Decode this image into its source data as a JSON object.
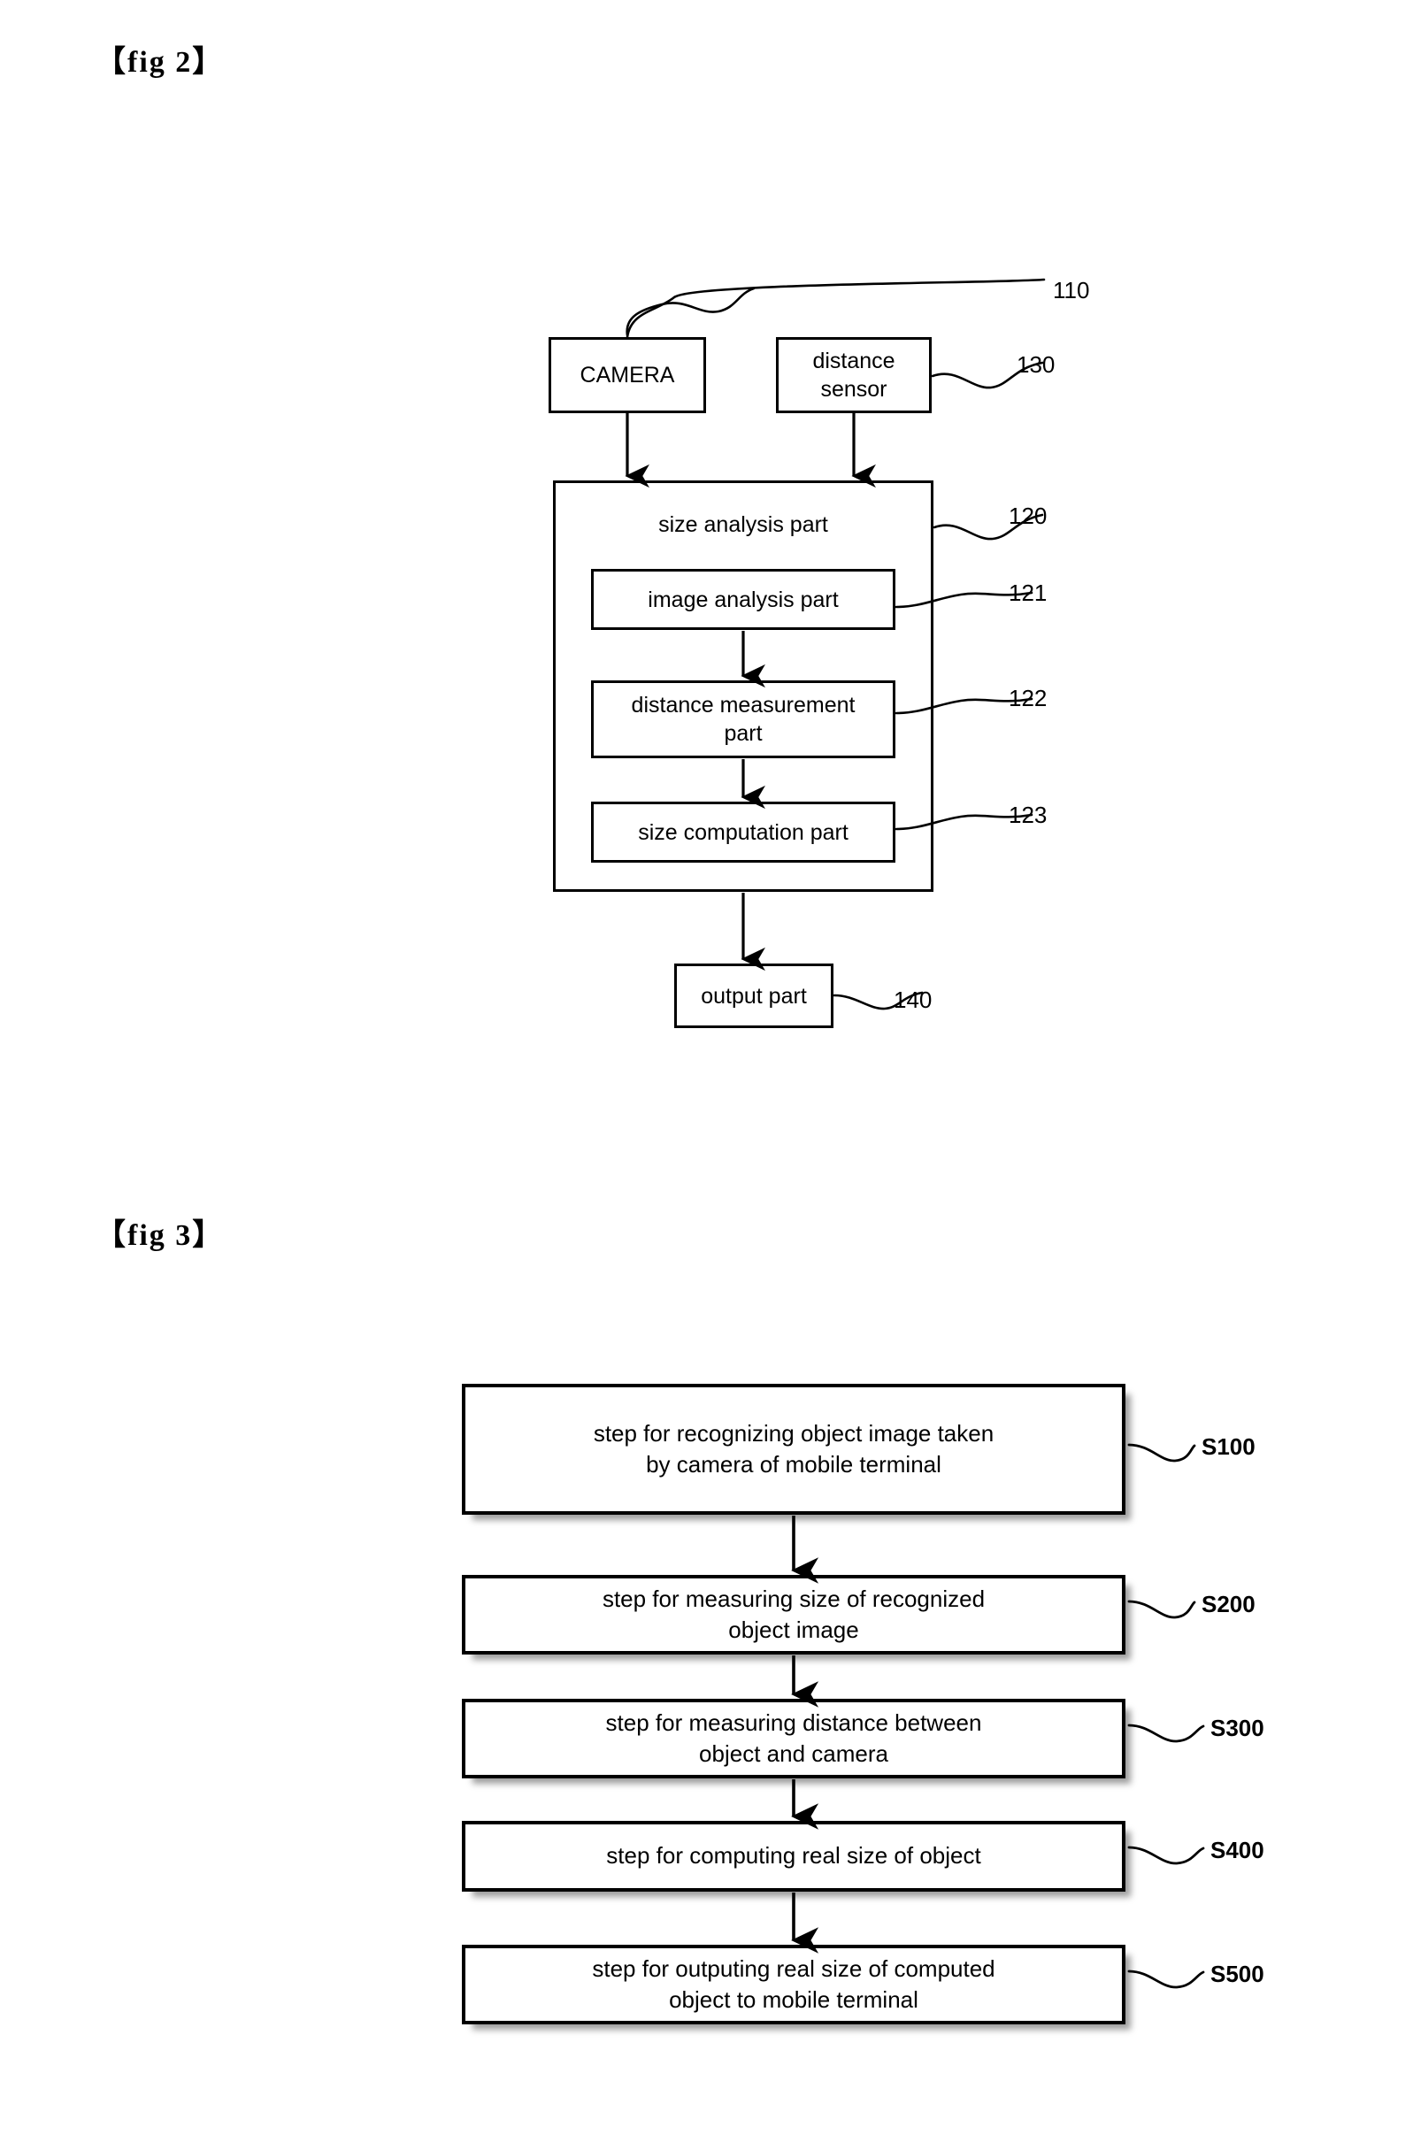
{
  "document": {
    "type": "patent-drawing-sheet",
    "figures": [
      {
        "caption": "【fig 2】",
        "kind": "block-diagram",
        "blocks": [
          {
            "id": "110",
            "label": "CAMERA"
          },
          {
            "id": "130",
            "label": "distance\nsensor"
          },
          {
            "id": "120",
            "label": "size analysis part"
          },
          {
            "id": "121",
            "label": "image analysis part"
          },
          {
            "id": "122",
            "label": "distance measurement\npart"
          },
          {
            "id": "123",
            "label": "size computation part"
          },
          {
            "id": "140",
            "label": "output part"
          }
        ]
      },
      {
        "caption": "【fig 3】",
        "kind": "flowchart",
        "steps": [
          {
            "id": "S100",
            "label": "step for recognizing object image taken\nby camera of  mobile terminal"
          },
          {
            "id": "S200",
            "label": "step for measuring size of recognized\nobject image"
          },
          {
            "id": "S300",
            "label": "step for measuring distance between\nobject and camera"
          },
          {
            "id": "S400",
            "label": "step for computing real size of object"
          },
          {
            "id": "S500",
            "label": "step for outputing real size of computed\nobject to mobile terminal"
          }
        ]
      }
    ]
  },
  "fig2": {
    "caption": "【fig 2】",
    "camera": {
      "label": "CAMERA",
      "ref": "110"
    },
    "distance_sensor": {
      "label": "distance",
      "label2": "sensor",
      "ref": "130"
    },
    "size_analysis": {
      "label": "size analysis part",
      "ref": "120"
    },
    "image_analysis": {
      "label": "image analysis part",
      "ref": "121"
    },
    "distance_measurement": {
      "label": "distance measurement",
      "label2": "part",
      "ref": "122"
    },
    "size_computation": {
      "label": "size computation part",
      "ref": "123"
    },
    "output": {
      "label": "output part",
      "ref": "140"
    }
  },
  "fig3": {
    "caption": "【fig 3】",
    "s100": {
      "line1": "step for recognizing object image taken",
      "line2": "by camera of  mobile terminal",
      "ref": "S100"
    },
    "s200": {
      "line1": "step for measuring size of recognized",
      "line2": "object image",
      "ref": "S200"
    },
    "s300": {
      "line1": "step for measuring distance between",
      "line2": "object and camera",
      "ref": "S300"
    },
    "s400": {
      "line1": "step for computing real size of object",
      "line2": "",
      "ref": "S400"
    },
    "s500": {
      "line1": "step for outputing real size of computed",
      "line2": "object to mobile terminal",
      "ref": "S500"
    }
  },
  "colors": {
    "stroke": "#000000",
    "background": "#ffffff",
    "shadow": "rgba(0,0,0,0.38)"
  }
}
